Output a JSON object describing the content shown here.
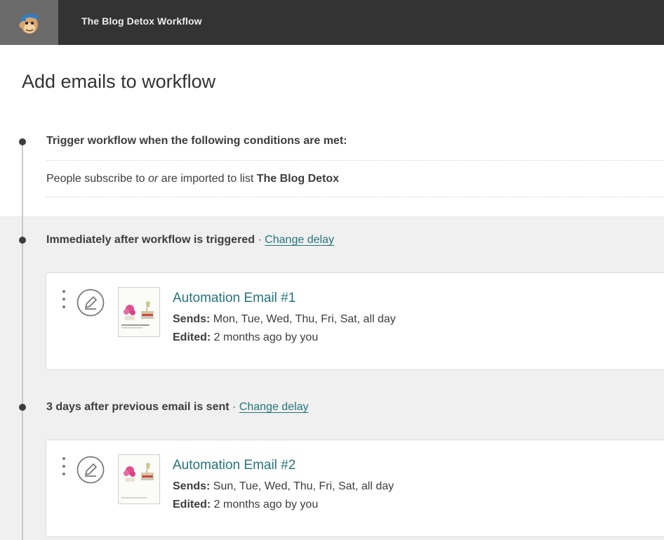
{
  "header": {
    "logo_icon": "mailchimp-freddie-logo",
    "title": "The Blog Detox Workflow"
  },
  "page": {
    "title": "Add emails to workflow"
  },
  "trigger": {
    "heading": "Trigger workflow when the following conditions are met:",
    "text_before": "People subscribe to ",
    "text_em": "or",
    "text_mid": " are imported to list ",
    "list_name": "The Blog Detox"
  },
  "steps": [
    {
      "delay_label": "Immediately after workflow is triggered",
      "separator": "·",
      "change_delay": "Change delay",
      "email": {
        "title": "Automation Email #1",
        "sends_label": "Sends:",
        "sends_value": "Mon, Tue, Wed, Thu, Fri, Sat, all day",
        "edited_label": "Edited:",
        "edited_value": "2 months ago by you"
      }
    },
    {
      "delay_label": "3 days after previous email is sent",
      "separator": "·",
      "change_delay": "Change delay",
      "email": {
        "title": "Automation Email #2",
        "sends_label": "Sends:",
        "sends_value": "Sun, Tue, Wed, Thu, Fri, Sat, all day",
        "edited_label": "Edited:",
        "edited_value": "2 months ago by you"
      }
    }
  ],
  "colors": {
    "topbar": "#333333",
    "logo_box": "#6b6b6b",
    "link_teal": "#25757c",
    "gray_area": "#f0f0f0"
  }
}
